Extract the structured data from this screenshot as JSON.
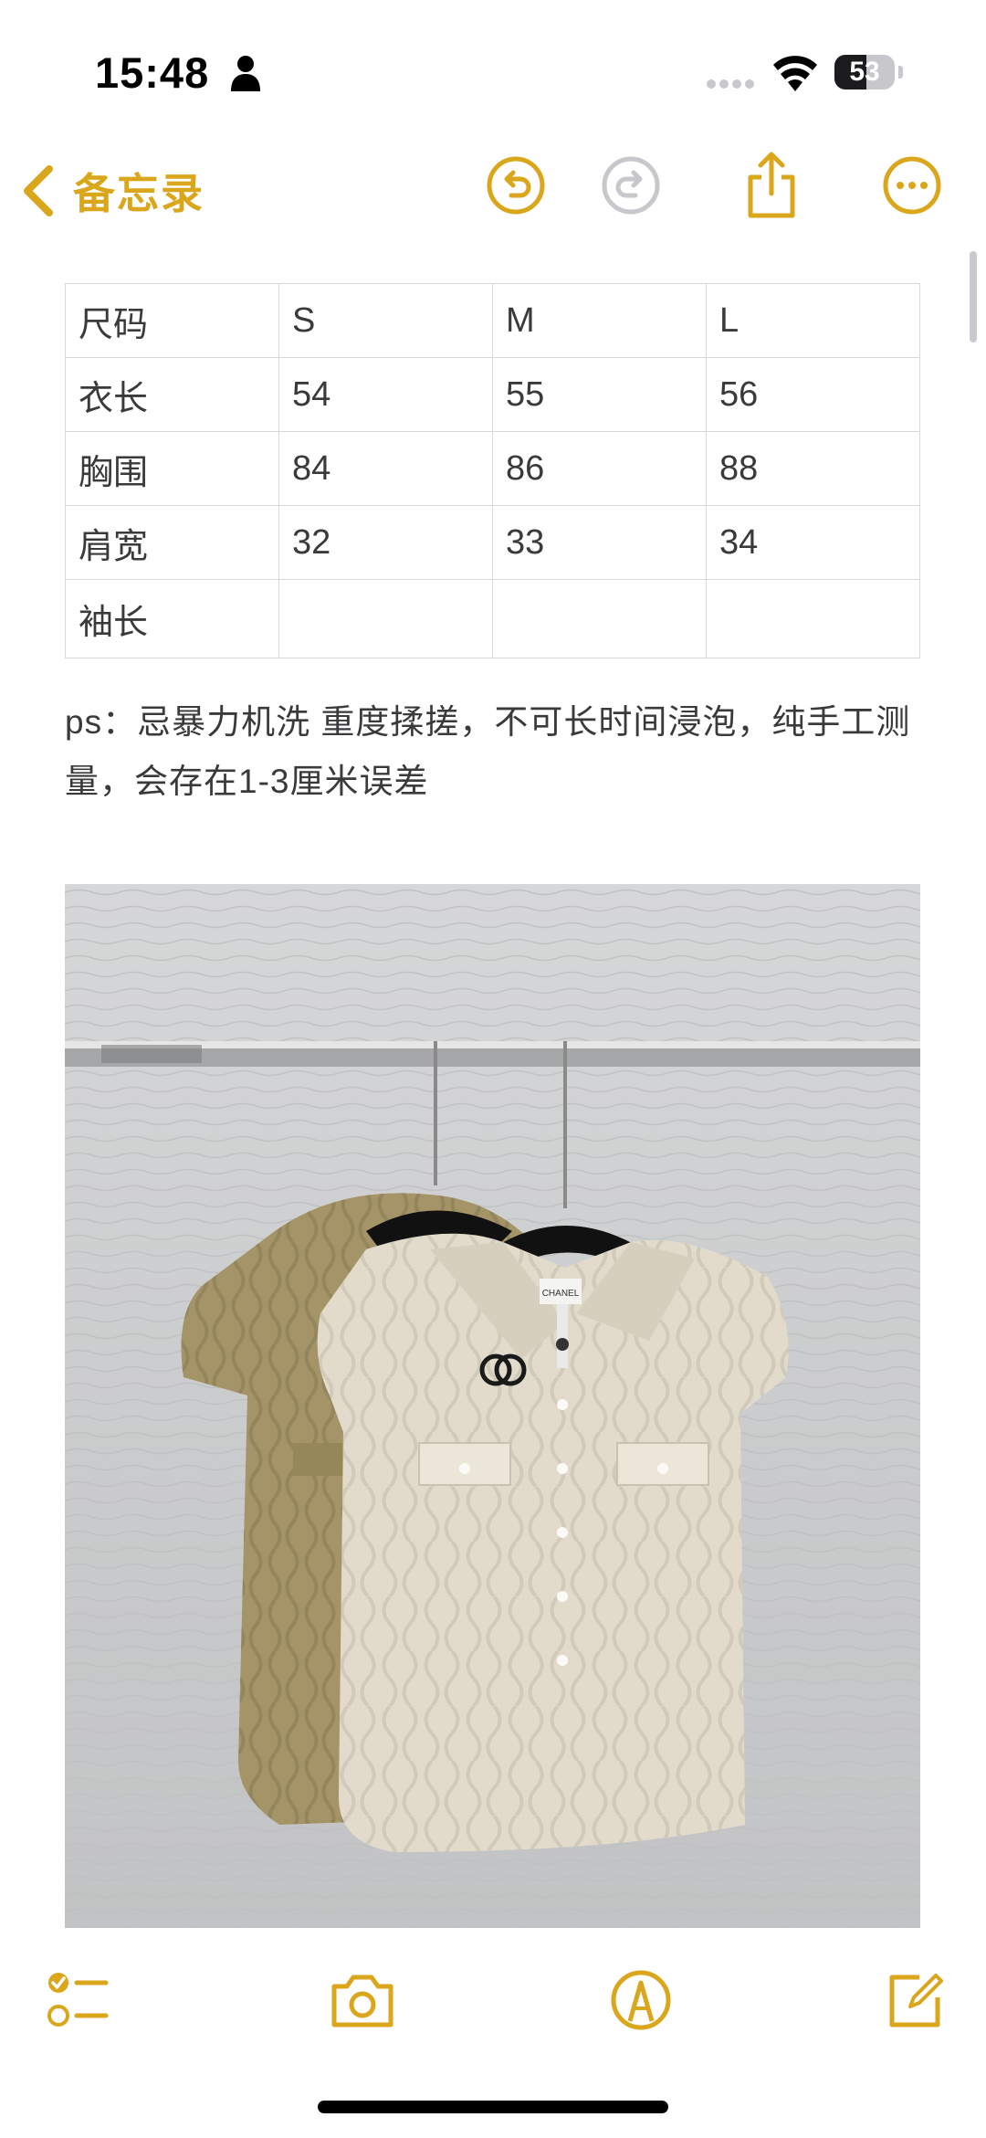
{
  "status_bar": {
    "time": "15:48",
    "battery_level": "53",
    "icons": [
      "person-icon",
      "signal-icon",
      "wifi-icon",
      "battery-icon"
    ]
  },
  "nav": {
    "back_label": "备忘录",
    "icons": [
      "chevron-left-icon",
      "undo-icon",
      "redo-icon",
      "share-icon",
      "more-icon"
    ],
    "accent_color": "#d9a61c",
    "disabled_color": "#c7c7cc"
  },
  "size_table": {
    "rows": [
      [
        "尺码",
        "S",
        "M",
        "L"
      ],
      [
        "衣长",
        "54",
        "55",
        "56"
      ],
      [
        "胸围",
        "84",
        "86",
        "88"
      ],
      [
        "肩宽",
        "32",
        "33",
        "34"
      ],
      [
        "袖长",
        "",
        "",
        ""
      ]
    ]
  },
  "note": {
    "text": "ps：忌暴力机洗 重度揉搓，不可长时间浸泡，纯手工测量，会存在1-3厘米误差"
  },
  "photo": {
    "tag_text": "CHANEL"
  },
  "toolbar": {
    "icons": [
      "checklist-icon",
      "camera-icon",
      "markup-icon",
      "compose-icon"
    ]
  }
}
